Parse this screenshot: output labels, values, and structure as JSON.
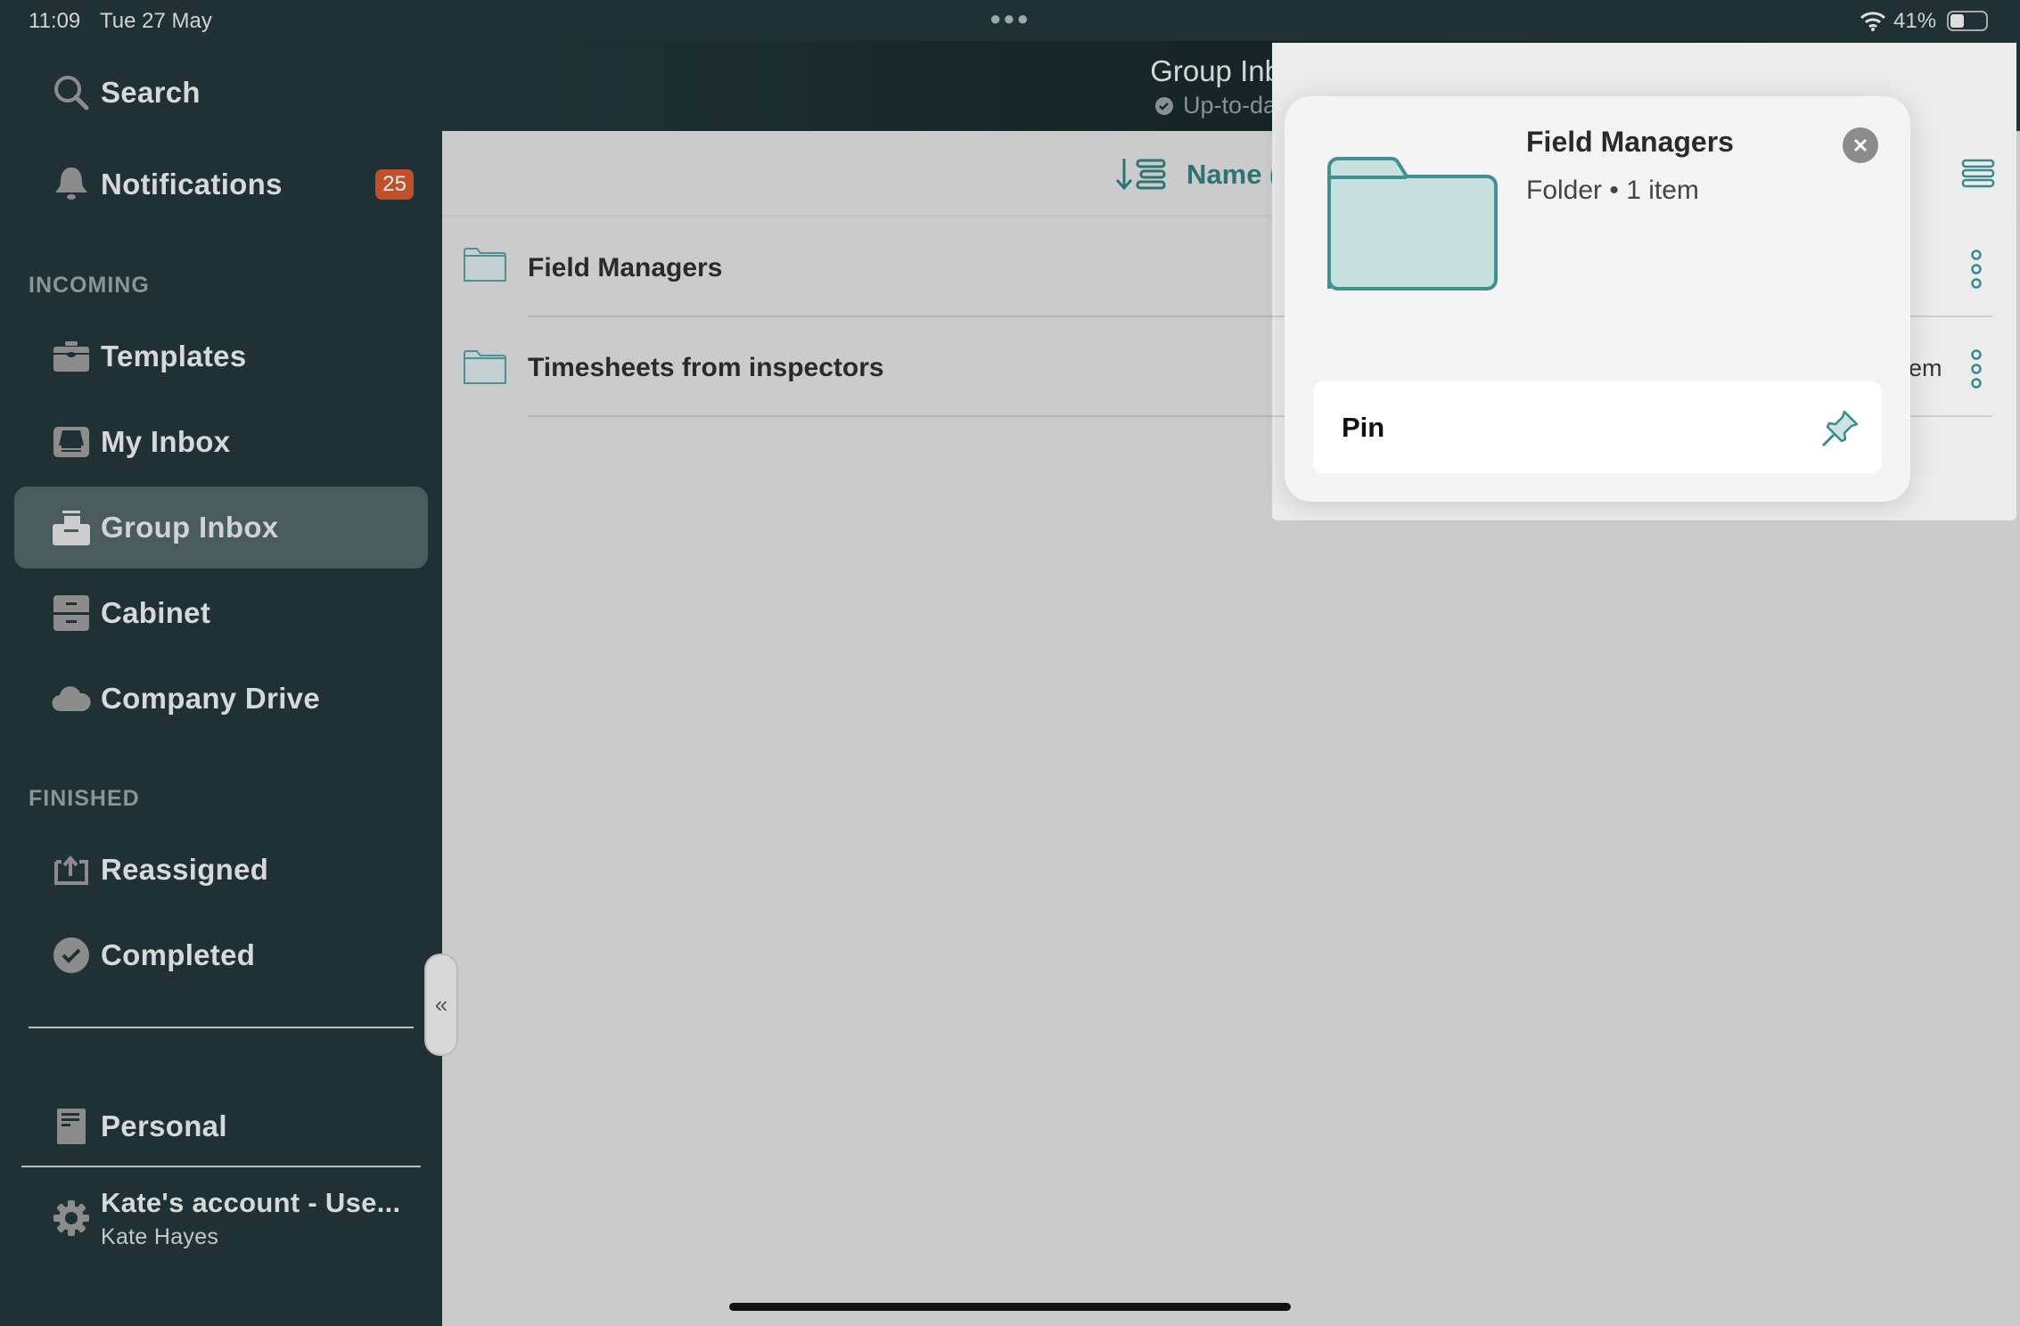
{
  "status_bar": {
    "time": "11:09",
    "date": "Tue 27 May",
    "battery": "41%",
    "battery_level": 0.41
  },
  "sidebar": {
    "top_items": [
      {
        "label": "Search",
        "icon": "search-icon"
      },
      {
        "label": "Notifications",
        "icon": "bell-icon",
        "badge": "25"
      }
    ],
    "incoming_title": "INCOMING",
    "incoming": [
      {
        "label": "Templates",
        "icon": "briefcase-icon"
      },
      {
        "label": "My Inbox",
        "icon": "inbox-tray-icon"
      },
      {
        "label": "Group Inbox",
        "icon": "group-inbox-icon",
        "active": true
      },
      {
        "label": "Cabinet",
        "icon": "cabinet-icon"
      },
      {
        "label": "Company Drive",
        "icon": "cloud-icon"
      }
    ],
    "finished_title": "FINISHED",
    "finished": [
      {
        "label": "Reassigned",
        "icon": "reassign-icon"
      },
      {
        "label": "Completed",
        "icon": "check-circle-icon"
      }
    ],
    "personal": {
      "label": "Personal",
      "icon": "document-icon"
    },
    "account": {
      "title": "Kate's account - Use...",
      "subtitle": "Kate Hayes",
      "icon": "gear-icon"
    },
    "collapse_icon": "«"
  },
  "header": {
    "title": "Group Inbox",
    "status": "Up-to-date"
  },
  "sort": {
    "label": "Name (A"
  },
  "rows": [
    {
      "name": "Field Managers"
    },
    {
      "name": "Timesheets from inspectors",
      "meta": "em"
    }
  ],
  "popover": {
    "title": "Field Managers",
    "subtitle": "Folder • 1 item",
    "action": "Pin"
  },
  "colors": {
    "sidebar": "#1f3135",
    "accent": "#3a8a8c",
    "badge": "#c0502a"
  }
}
